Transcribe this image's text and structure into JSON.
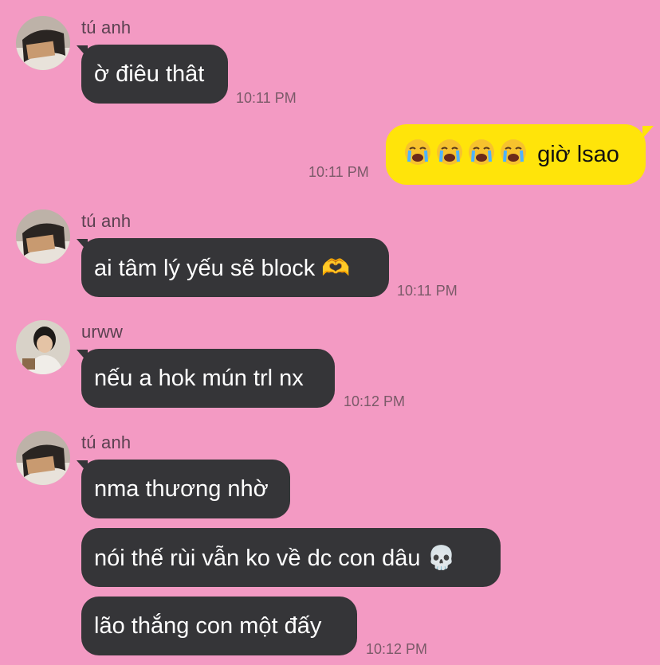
{
  "messages": [
    {
      "sender": "tú anh",
      "text": "ờ điêu thât",
      "time": "10:11 PM"
    },
    {
      "text": "giờ lsao",
      "emoji_icons": [
        "loudly-crying-face",
        "loudly-crying-face",
        "loudly-crying-face",
        "loudly-crying-face"
      ],
      "time": "10:11 PM"
    },
    {
      "sender": "tú anh",
      "text": "ai tâm lý yếu sẽ block",
      "emoji": "🫶",
      "emoji_icon": "heart-hands",
      "time": "10:11 PM"
    },
    {
      "sender": "urww",
      "text": "nếu a hok mún trl nx",
      "time": "10:12 PM"
    },
    {
      "sender": "tú anh",
      "texts": [
        "nma thương nhờ",
        "nói thế rùi vẫn ko về dc con dâu",
        "lão thắng con một đấy"
      ],
      "emoji": "💀",
      "emoji_icon": "skull",
      "time": "10:12 PM"
    }
  ],
  "colors": {
    "background": "#f39ac3",
    "incoming_bubble": "#353538",
    "outgoing_bubble": "#ffe40a"
  }
}
